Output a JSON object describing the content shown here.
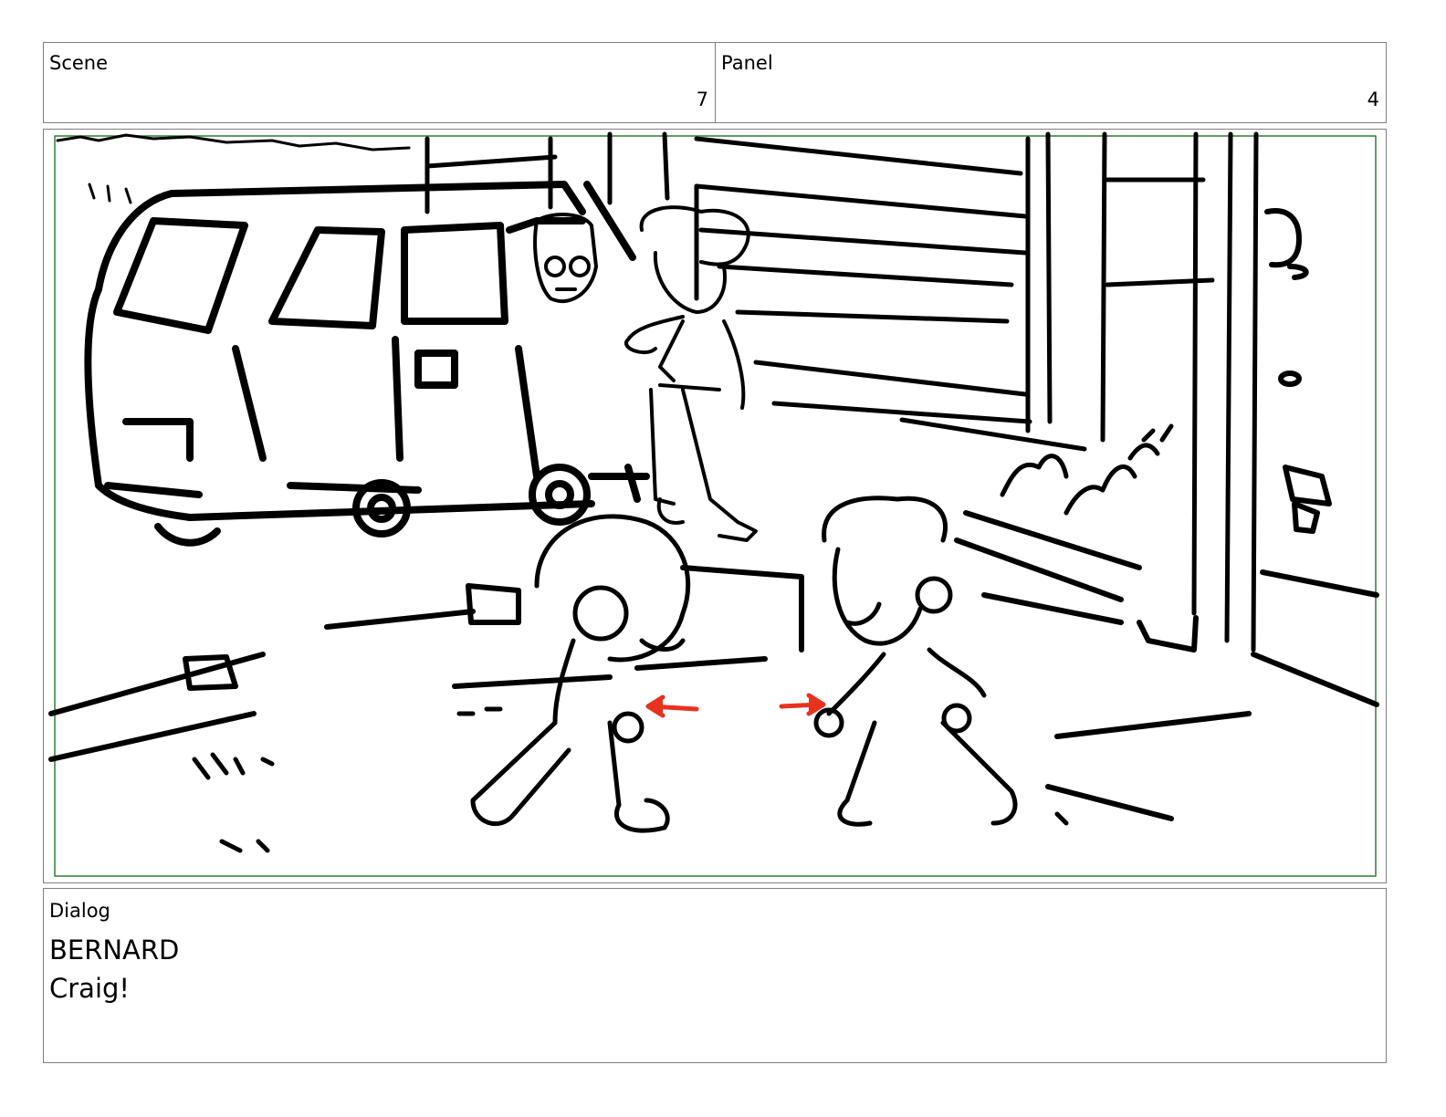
{
  "header": {
    "scene_label": "Scene",
    "scene_value": "7",
    "panel_label": "Panel",
    "panel_value": "4"
  },
  "panel_image": {
    "safe_area_color": "#2e7d32",
    "motion_arrow_color": "#e8321e"
  },
  "dialog": {
    "label": "Dialog",
    "speaker": "BERNARD",
    "line": "Craig!"
  }
}
